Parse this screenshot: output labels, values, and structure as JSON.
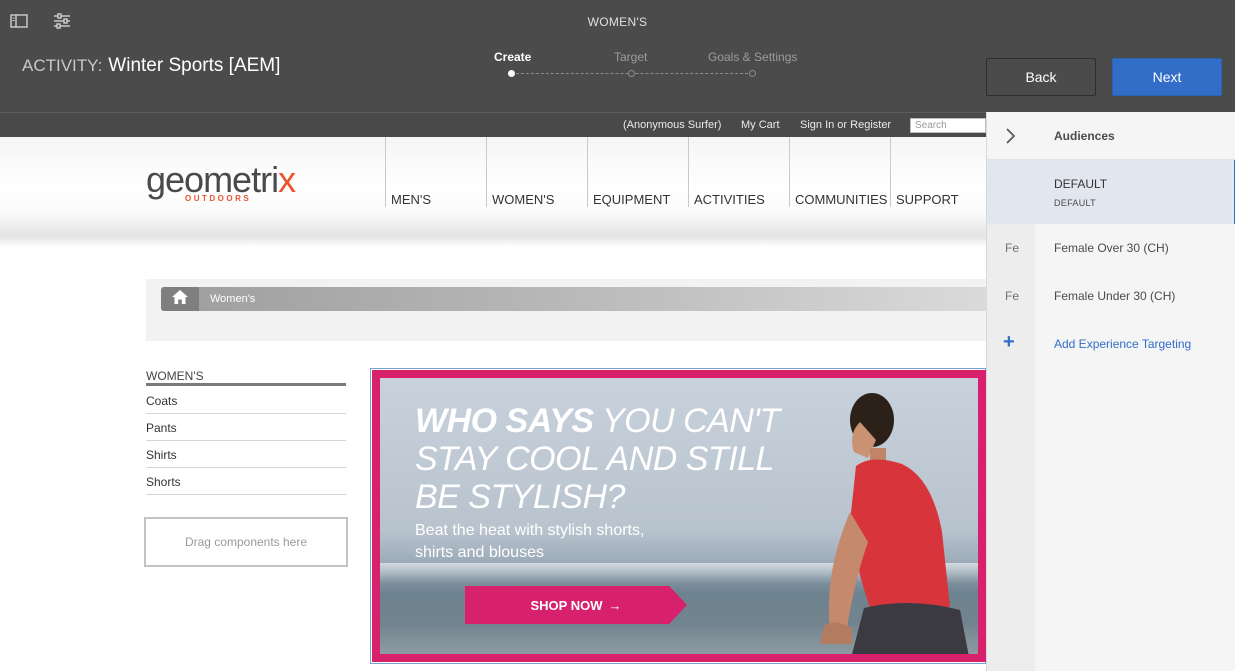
{
  "editor": {
    "page_name": "WOMEN'S",
    "activity_label": "ACTIVITY:",
    "activity_name": "Winter Sports [AEM]",
    "steps": [
      {
        "label": "Create",
        "active": true
      },
      {
        "label": "Target",
        "active": false
      },
      {
        "label": "Goals & Settings",
        "active": false
      }
    ],
    "back_label": "Back",
    "next_label": "Next",
    "accent_color": "#326ec8",
    "icons": [
      "sidebar-toggle-icon",
      "properties-icon"
    ]
  },
  "site": {
    "util_links": [
      "(Anonymous Surfer)",
      "My Cart",
      "Sign In or Register"
    ],
    "search_placeholder": "Search",
    "logo_main": "geometri",
    "logo_x": "x",
    "logo_sub": "OUTDOORS",
    "nav": [
      "MEN'S",
      "WOMEN'S",
      "EQUIPMENT",
      "ACTIVITIES",
      "COMMUNITIES",
      "SUPPORT"
    ],
    "breadcrumb": {
      "icon": "home-icon",
      "current": "Women's"
    },
    "sidenav": {
      "title": "WOMEN'S",
      "links": [
        "Coats",
        "Pants",
        "Shirts",
        "Shorts"
      ]
    },
    "drop_zone": "Drag components here",
    "hero": {
      "headline_bold": "WHO SAYS",
      "headline_rest": " YOU CAN'T",
      "headline_line2": "STAY COOL AND STILL",
      "headline_line3": "BE STYLISH?",
      "subtext": "Beat the heat with stylish shorts, shirts and blouses",
      "cta": "SHOP NOW",
      "brand_color": "#d7216d"
    }
  },
  "panel": {
    "title": "Audiences",
    "default": {
      "name": "DEFAULT",
      "experience": "DEFAULT"
    },
    "audiences": [
      {
        "abbr": "Fe",
        "name": "Female Over 30 (CH)"
      },
      {
        "abbr": "Fe",
        "name": "Female Under 30 (CH)"
      }
    ],
    "add_label": "Add Experience Targeting"
  }
}
